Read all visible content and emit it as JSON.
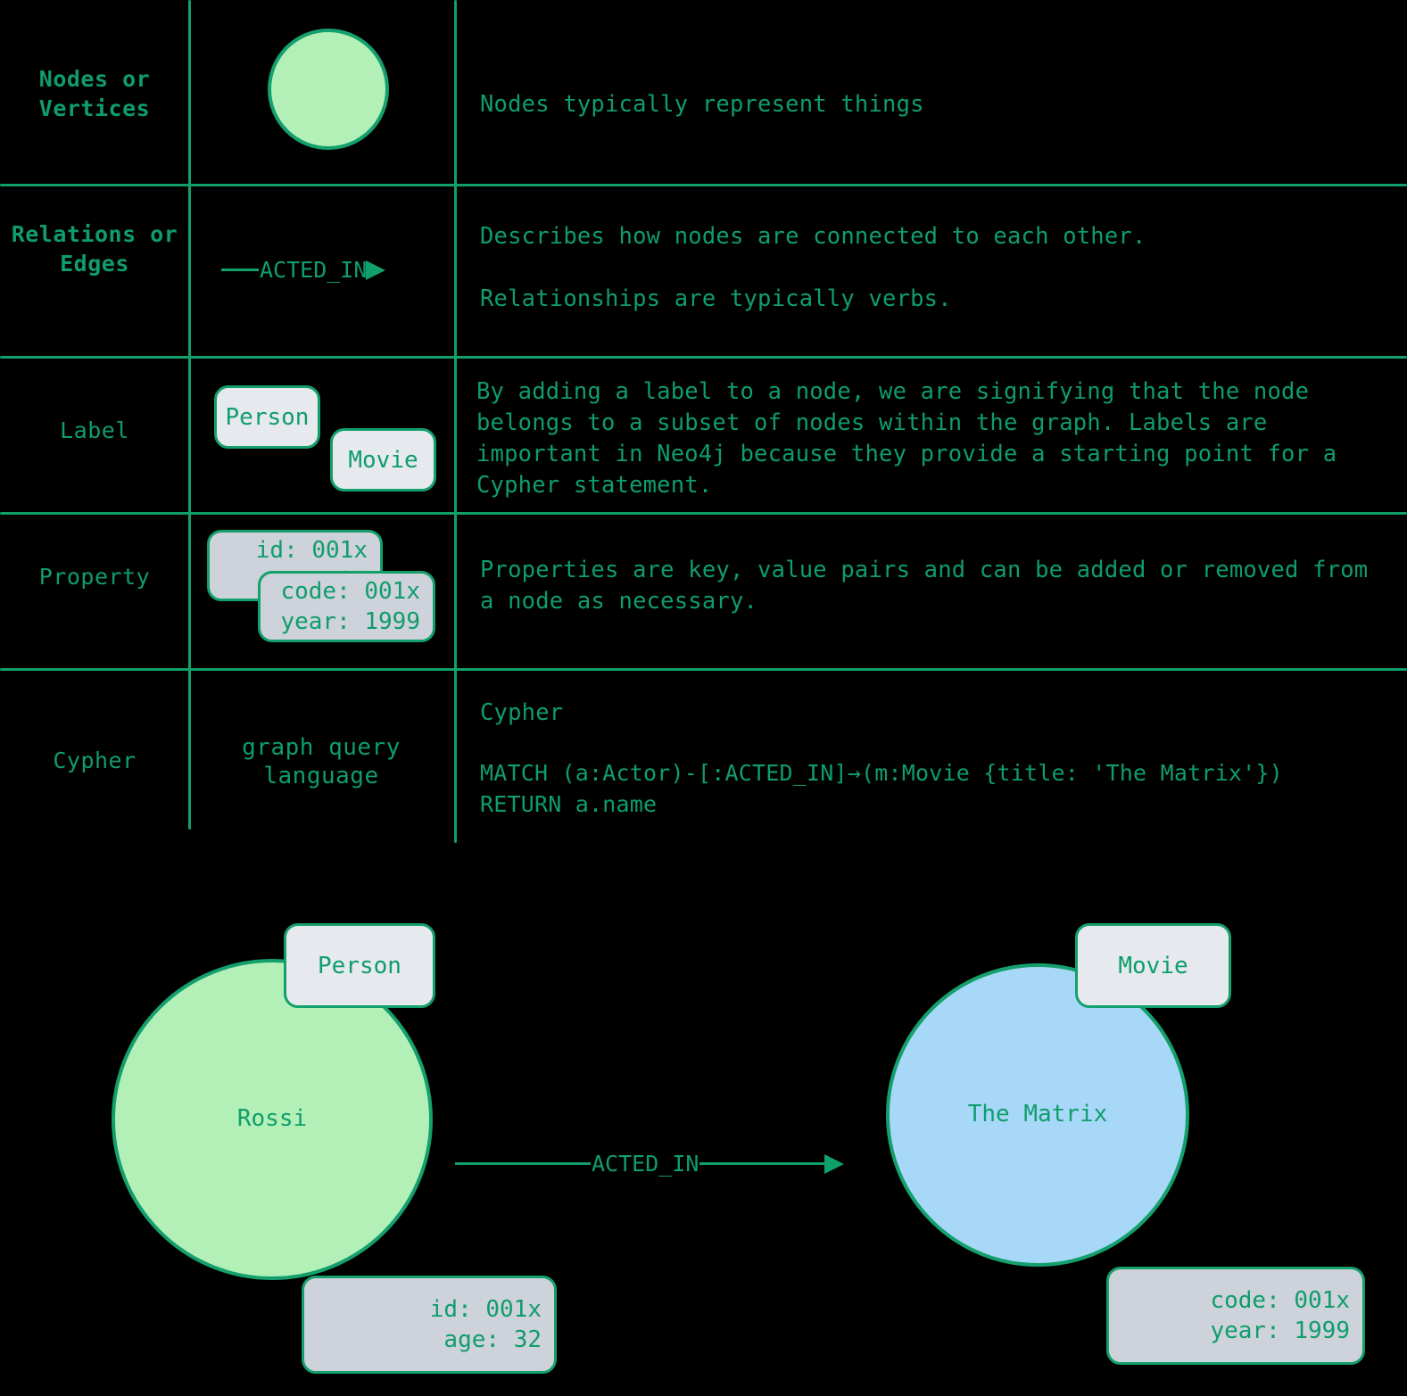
{
  "legend_table": {
    "rows": [
      {
        "term": "Nodes\nor\nVertices",
        "visual": "green-circle",
        "description": "Nodes typically represent things"
      },
      {
        "term": "Relations\nor\nEdges",
        "visual": "arrow",
        "arrow_label": "ACTED_IN",
        "description": "Describes how nodes are connected to each other.\n\nRelationships are typically verbs."
      },
      {
        "term": "Label",
        "visual": "label-chips",
        "chips": [
          "Person",
          "Movie"
        ],
        "description": "By adding a label to a node, we are signifying that the node belongs to a subset of nodes within the graph. Labels are important in Neo4j because they provide a starting point for a Cypher statement."
      },
      {
        "term": "Property",
        "visual": "property-chips",
        "chips": [
          "id: 001x\nage: 32",
          "code: 001x\nyear: 1999"
        ],
        "description": "Properties are key, value pairs and can be added or removed from a node as necessary."
      },
      {
        "term": "Cypher",
        "visual": "text",
        "middle_text": "graph query\nlanguage",
        "description_heading": "Cypher",
        "description_code": "MATCH (a:Actor)-[:ACTED_IN]→(m:Movie {title: 'The Matrix'})\nRETURN a.name"
      }
    ]
  },
  "graph": {
    "person_node": {
      "caption": "Rossi",
      "label_chip": "Person",
      "property_chip": "id: 001x\nage: 32",
      "fill": "#b3f0b8"
    },
    "movie_node": {
      "caption": "The Matrix",
      "label_chip": "Movie",
      "property_chip": "code: 001x\nyear: 1999",
      "fill": "#a8d8f8"
    },
    "relationship_label": "ACTED_IN"
  },
  "colors": {
    "accent": "#10a06a",
    "text": "#0f9d6b",
    "node_green": "#b3f0b8",
    "node_blue": "#a8d8f8",
    "chip_label_bg": "#e6e9ed",
    "chip_property_bg": "#ced2da",
    "background": "#000000"
  }
}
